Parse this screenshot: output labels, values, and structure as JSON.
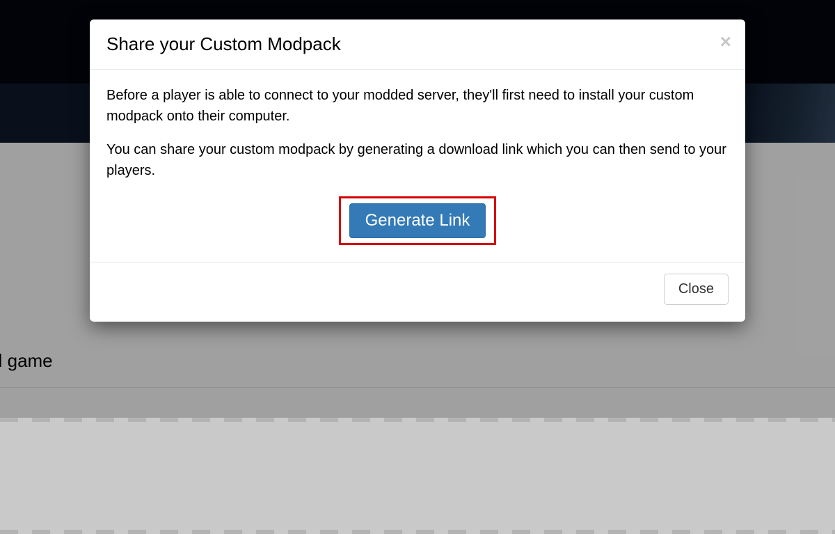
{
  "background": {
    "partial_text": "and game"
  },
  "modal": {
    "title": "Share your Custom Modpack",
    "close_glyph": "×",
    "body": {
      "paragraph1": "Before a player is able to connect to your modded server, they'll first need to install your custom modpack onto their computer.",
      "paragraph2": "You can share your custom modpack by generating a download link which you can then send to your players."
    },
    "generate_button_label": "Generate Link",
    "footer": {
      "close_label": "Close"
    }
  }
}
